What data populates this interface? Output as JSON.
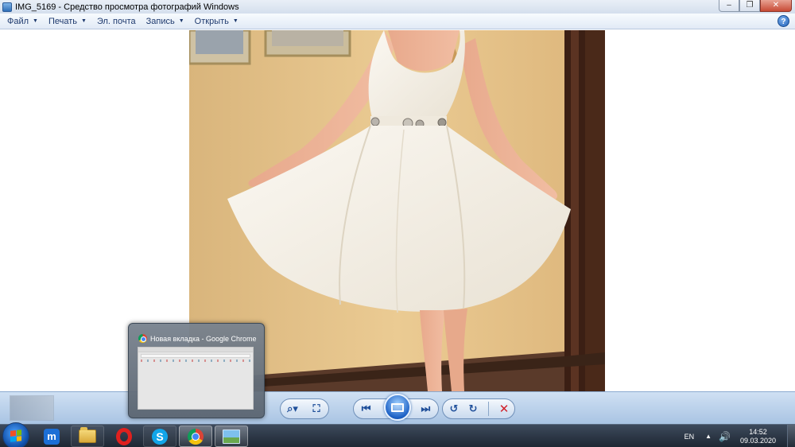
{
  "window": {
    "title": "IMG_5169 - Средство просмотра фотографий Windows",
    "minimize_glyph": "–",
    "restore_glyph": "❐",
    "close_glyph": "✕"
  },
  "menu": {
    "items": [
      {
        "label": "Файл",
        "has_dropdown": true
      },
      {
        "label": "Печать",
        "has_dropdown": true
      },
      {
        "label": "Эл. почта",
        "has_dropdown": false
      },
      {
        "label": "Запись",
        "has_dropdown": true
      },
      {
        "label": "Открыть",
        "has_dropdown": true
      }
    ],
    "help_glyph": "?"
  },
  "controls": {
    "zoom_glyph": "⌕▾",
    "actual_size_glyph": "⛶",
    "prev_glyph": "⏮",
    "next_glyph": "⏭",
    "rotate_ccw_glyph": "↺",
    "rotate_cw_glyph": "↻",
    "delete_glyph": "✕"
  },
  "preview": {
    "title": "Новая вкладка - Google Chrome"
  },
  "taskbar": {
    "maxthon_glyph": "m",
    "skype_glyph": "S",
    "language": "EN",
    "tray_arrow": "▲",
    "speaker_glyph": "🔊",
    "time": "14:52",
    "date": "09.03.2020"
  },
  "colors": {
    "wall": "#e6c38a",
    "dress": "#f6f2ea",
    "frame": "#3b1f14",
    "accent_blue": "#1f4f9a",
    "delete_red": "#d0202a"
  }
}
